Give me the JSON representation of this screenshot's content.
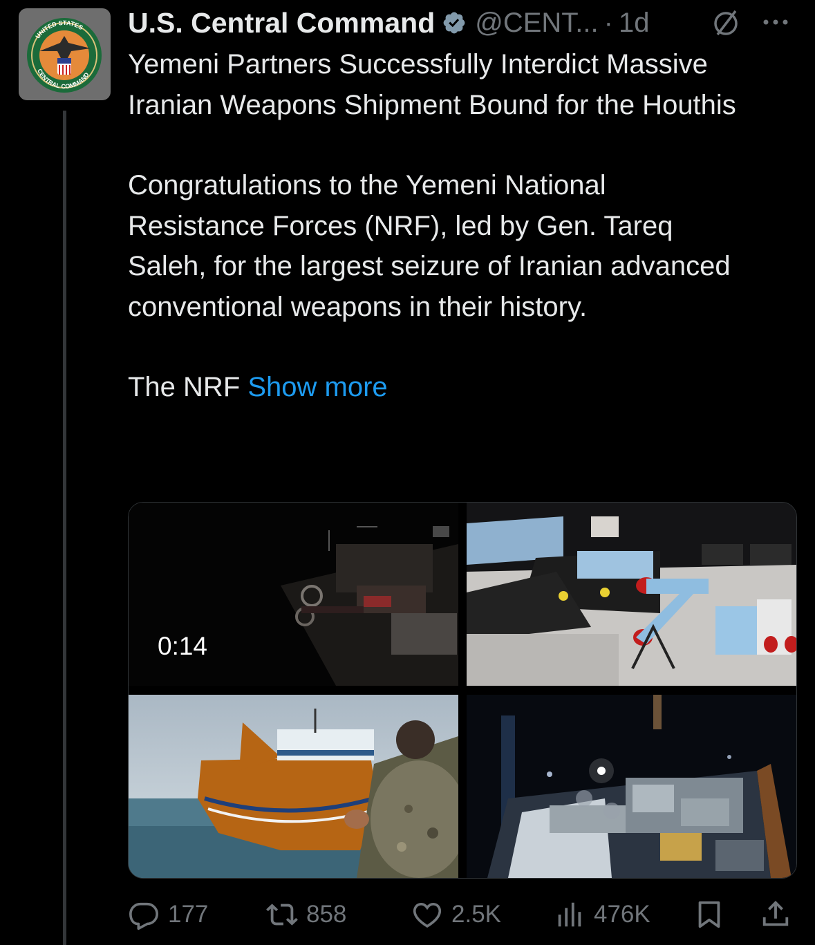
{
  "tweet": {
    "author_name": "U.S. Central Command",
    "handle": "@CENT...",
    "separator": "·",
    "time": "1d",
    "avatar_text_top": "UNITED STATES",
    "avatar_text_bottom": "CENTRAL COMMAND",
    "paragraphs": [
      "Yemeni Partners Successfully Interdict Massive Iranian Weapons Shipment Bound for the Houthis",
      "Congratulations to the Yemeni National Resistance  Forces (NRF), led by Gen. Tareq Saleh, for the largest seizure of  Iranian advanced conventional weapons in their history."
    ],
    "truncated_text": "The NRF ",
    "show_more_label": "Show more",
    "video_duration": "0:14"
  },
  "actions": {
    "replies": "177",
    "reposts": "858",
    "likes": "2.5K",
    "views": "476K"
  },
  "colors": {
    "background": "#000000",
    "text": "#e7e9ea",
    "secondary": "#71767b",
    "accent": "#1d9bf0"
  },
  "icons": [
    "verified-badge-icon",
    "grok-icon",
    "more-options-icon",
    "reply-icon",
    "repost-icon",
    "like-icon",
    "views-icon",
    "bookmark-icon",
    "share-icon"
  ]
}
